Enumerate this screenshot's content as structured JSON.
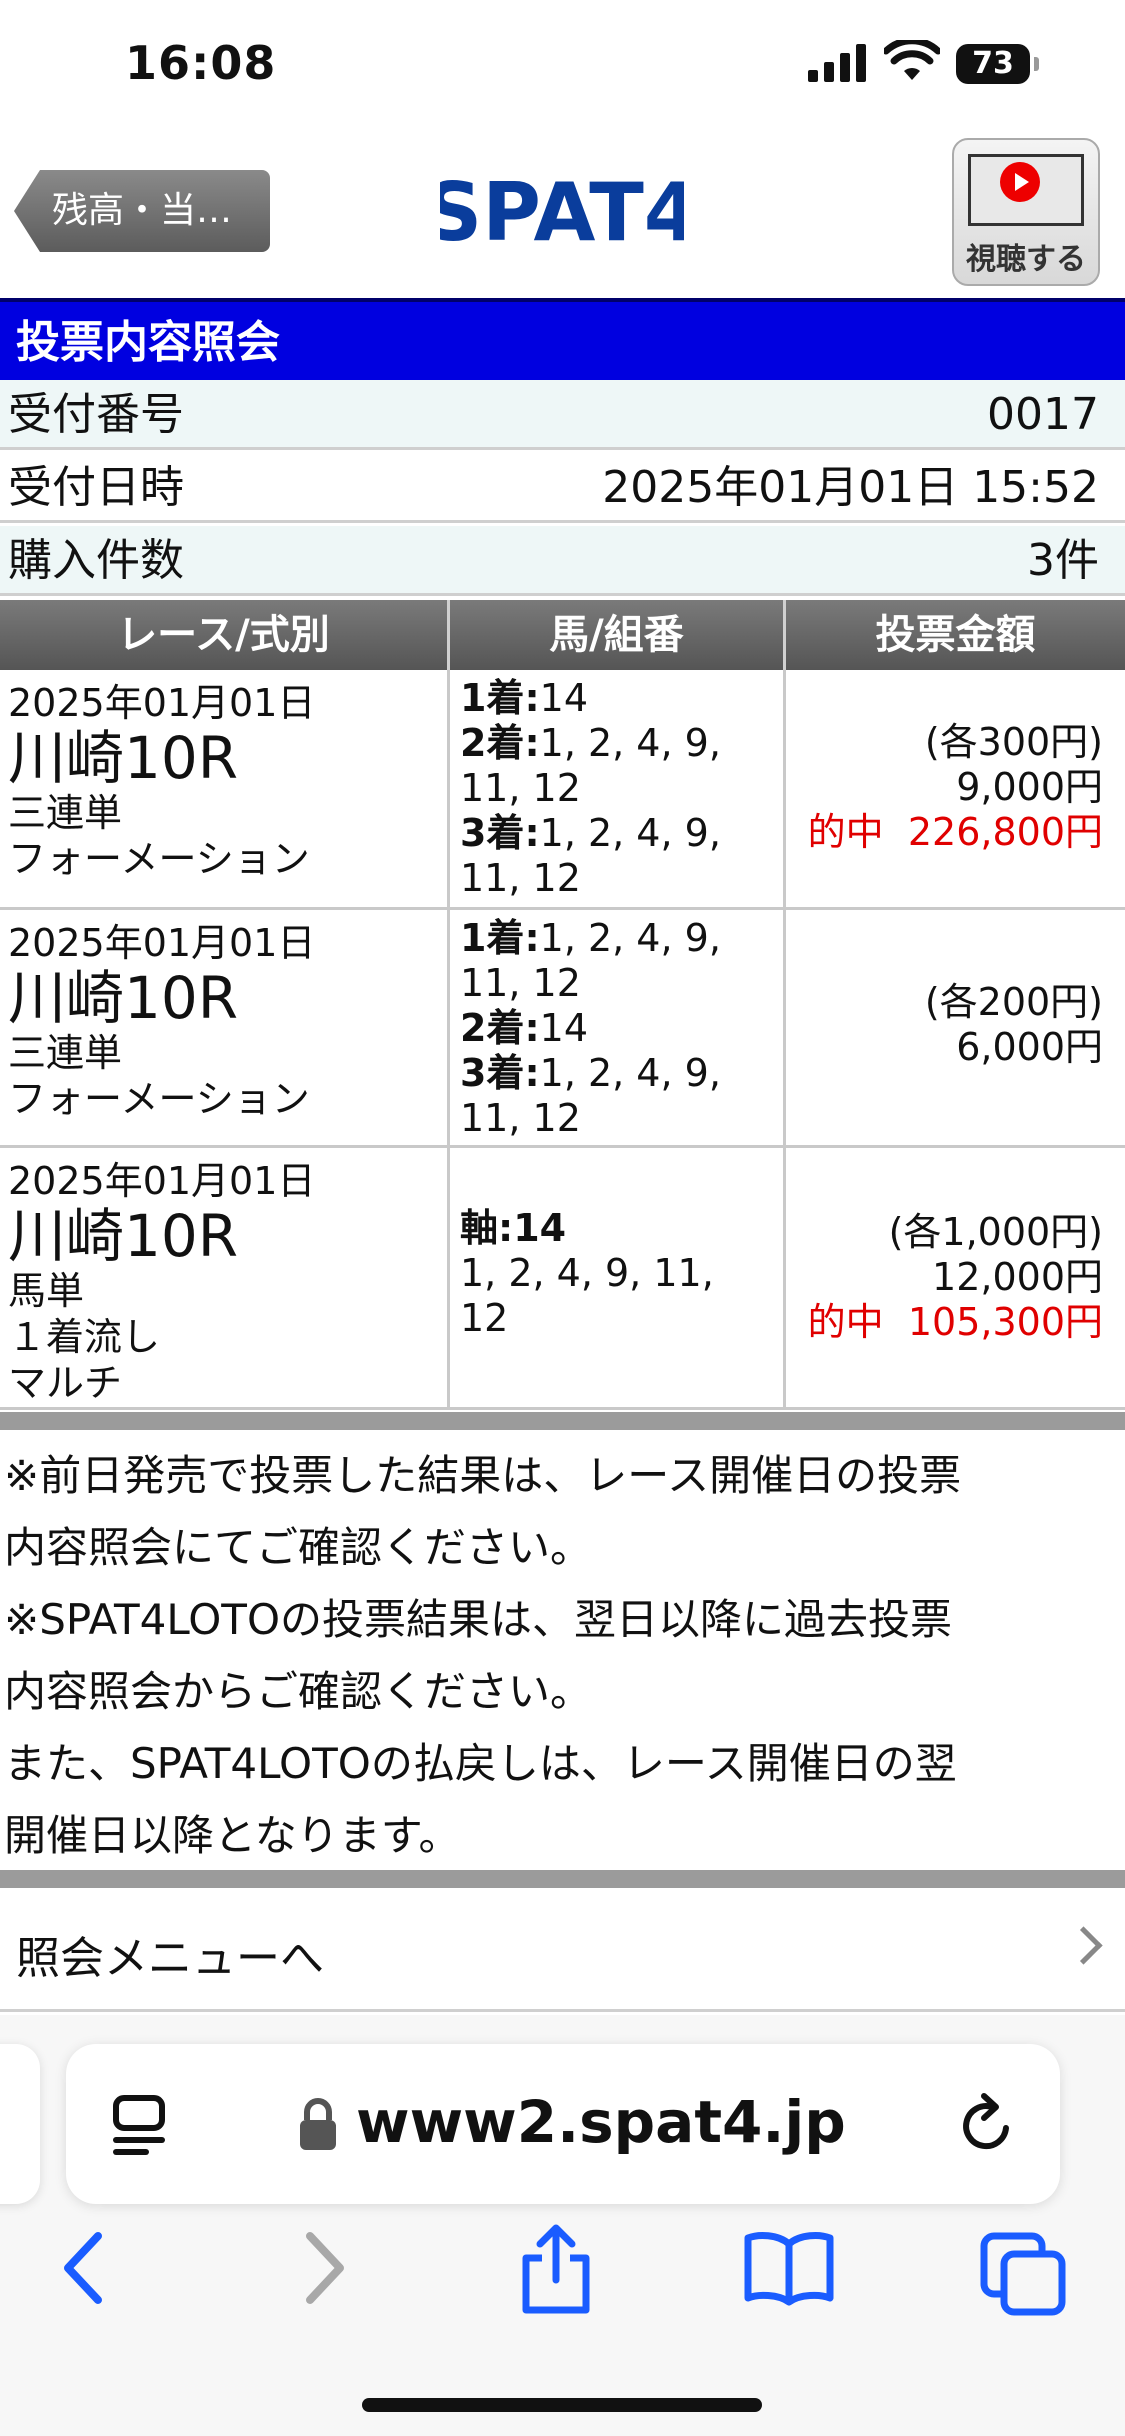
{
  "status_bar": {
    "time": "16:08",
    "battery": "73"
  },
  "header": {
    "back_label": "残高・当…",
    "logo_text": "SPAT4",
    "watch_label": "視聴する"
  },
  "title": "投票内容照会",
  "info": [
    {
      "key": "受付番号",
      "value": "0017"
    },
    {
      "key": "受付日時",
      "value": "2025年01月01日 15:52"
    },
    {
      "key": "購入件数",
      "value": "3件"
    }
  ],
  "table": {
    "headers": [
      "レース/式別",
      "馬/組番",
      "投票金額"
    ],
    "rows": [
      {
        "date": "2025年01月01日",
        "race": "川崎10R",
        "type1": "三連単",
        "type2": "フォーメーション",
        "type3": "",
        "combo": [
          [
            "1着:",
            "14"
          ],
          [
            "2着:",
            "1, 2, 4, 9,"
          ],
          [
            "",
            "11, 12"
          ],
          [
            "3着:",
            "1, 2, 4, 9,"
          ],
          [
            "",
            "11, 12"
          ]
        ],
        "unit": "(各300円)",
        "total": "9,000円",
        "hit_label": "的中",
        "hit_amount": "226,800円"
      },
      {
        "date": "2025年01月01日",
        "race": "川崎10R",
        "type1": "三連単",
        "type2": "フォーメーション",
        "type3": "",
        "combo": [
          [
            "1着:",
            "1, 2, 4, 9,"
          ],
          [
            "",
            "11, 12"
          ],
          [
            "2着:",
            "14"
          ],
          [
            "3着:",
            "1, 2, 4, 9,"
          ],
          [
            "",
            "11, 12"
          ]
        ],
        "unit": "(各200円)",
        "total": "6,000円",
        "hit_label": "",
        "hit_amount": ""
      },
      {
        "date": "2025年01月01日",
        "race": "川崎10R",
        "type1": "馬単",
        "type2": "１着流し",
        "type3": "マルチ",
        "combo": [
          [
            "軸:14",
            ""
          ],
          [
            "",
            "1, 2, 4, 9, 11,"
          ],
          [
            "",
            "12"
          ]
        ],
        "unit": "(各1,000円)",
        "total": "12,000円",
        "hit_label": "的中",
        "hit_amount": "105,300円"
      }
    ]
  },
  "notes": [
    "※前日発売で投票した結果は、レース開催日の投票",
    "内容照会にてご確認ください。",
    "※SPAT4LOTOの投票結果は、翌日以降に過去投票",
    "内容照会からご確認ください。",
    "また、SPAT4LOTOの払戻しは、レース開催日の翌",
    "開催日以降となります。"
  ],
  "menu_link": "照会メニューへ",
  "browser": {
    "url": "www2.spat4.jp"
  },
  "colors": {
    "title_bg": "#0000e0",
    "hit": "#e00000",
    "header_gray": "#666666"
  }
}
